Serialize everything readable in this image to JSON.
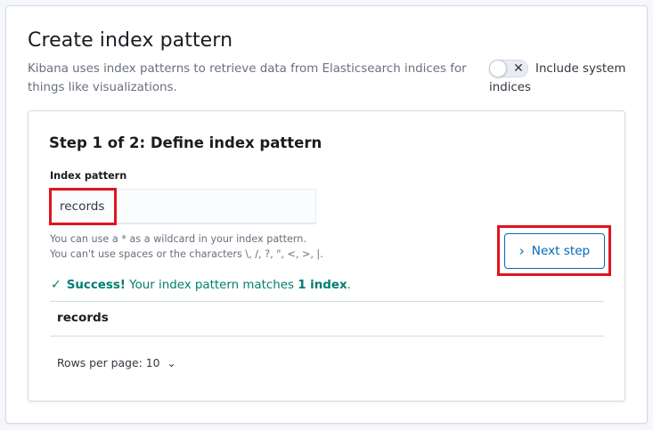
{
  "header": {
    "title": "Create index pattern",
    "description": "Kibana uses index patterns to retrieve data from Elasticsearch indices for things like visualizations."
  },
  "toggle": {
    "label": "Include system indices",
    "checked": false,
    "icon": "x-icon"
  },
  "step": {
    "title": "Step 1 of 2: Define index pattern",
    "field_label": "Index pattern",
    "input_value": "records",
    "help_line1": "You can use a * as a wildcard in your index pattern.",
    "help_line2": "You can't use spaces or the characters \\, /, ?, \", <, >, |.",
    "next_label": "Next step",
    "next_icon": "chevron-right-icon"
  },
  "result": {
    "success_strong": "Success!",
    "success_text": " Your index pattern matches ",
    "success_count": "1 index",
    "success_end": ".",
    "check_icon": "check-icon",
    "matches": [
      "records"
    ]
  },
  "pagination": {
    "rows_per_page_label": "Rows per page: 10",
    "icon": "chevron-down-icon"
  },
  "colors": {
    "accent": "#006bb8",
    "success": "#017d73",
    "highlight": "#e0141e"
  }
}
